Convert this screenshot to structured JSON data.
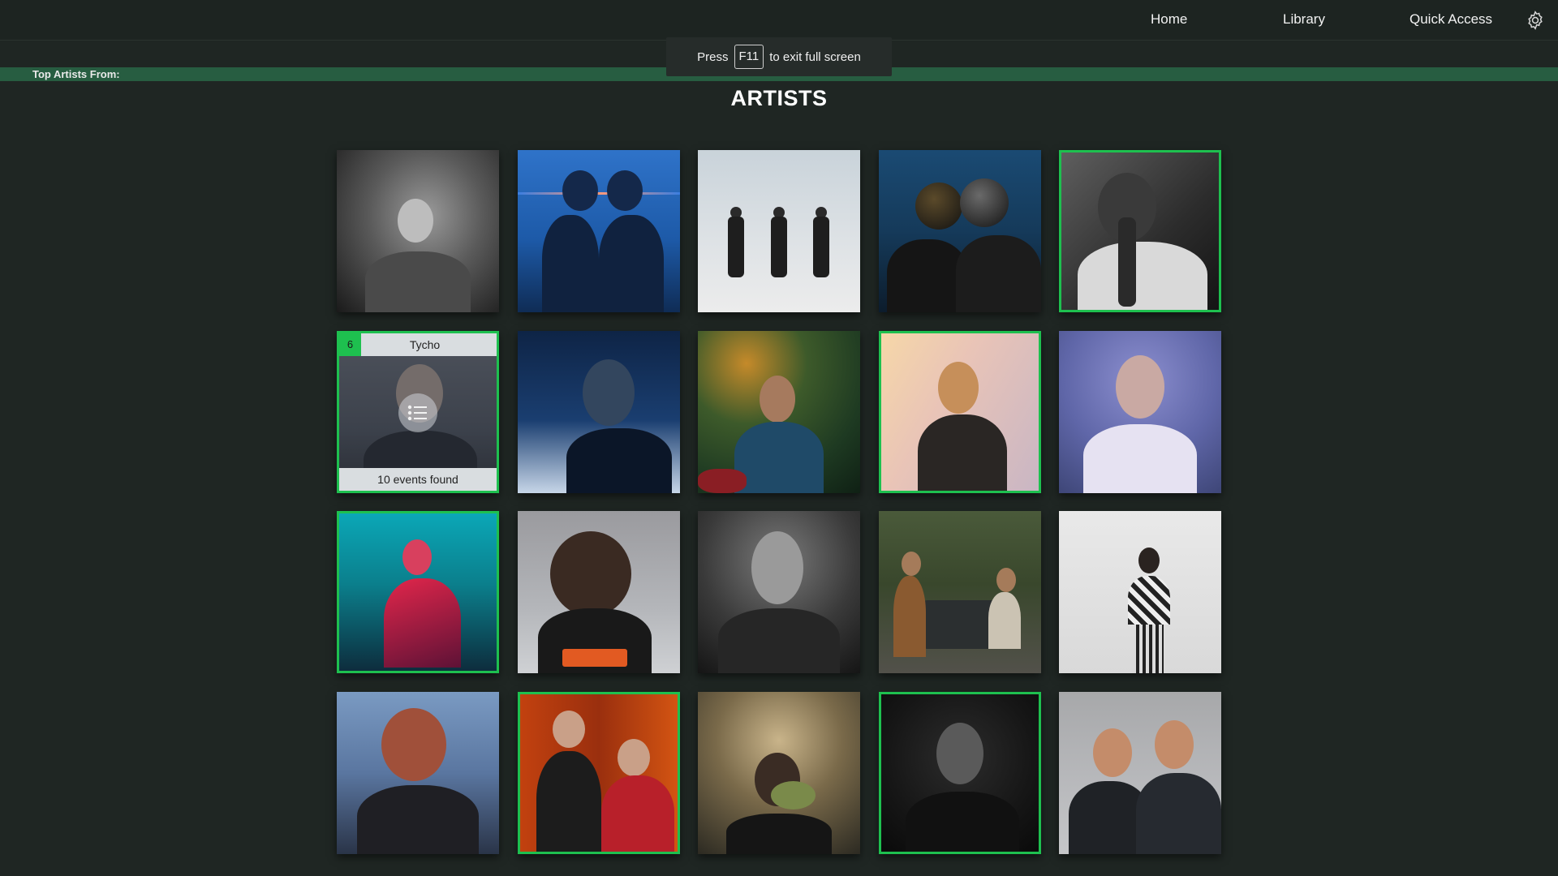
{
  "nav": {
    "home": "Home",
    "library": "Library",
    "quick_access": "Quick Access",
    "settings_icon": "gear-icon"
  },
  "fullscreen_toast": {
    "press": "Press",
    "key": "F11",
    "message": "to exit full screen"
  },
  "top_artists_label": "Top Artists From:",
  "page_title": "ARTISTS",
  "hovered_tile": {
    "rank": "6",
    "name": "Tycho",
    "events": "10 events found",
    "icon": "list-icon"
  },
  "colors": {
    "accent_green": "#1ec04f",
    "background": "#1f2623",
    "bar_green": "#275d41"
  }
}
